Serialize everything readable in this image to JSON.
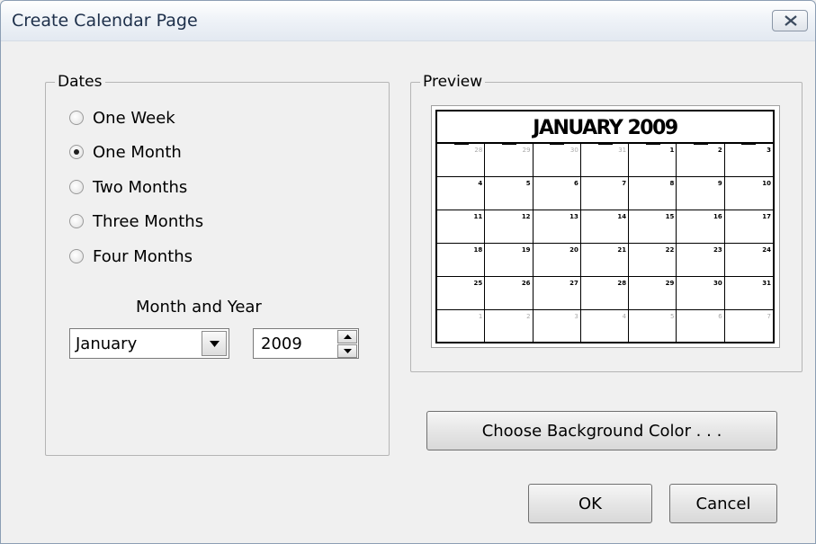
{
  "window": {
    "title": "Create Calendar Page"
  },
  "dates": {
    "legend": "Dates",
    "options": [
      {
        "label": "One Week",
        "checked": false
      },
      {
        "label": "One Month",
        "checked": true
      },
      {
        "label": "Two Months",
        "checked": false
      },
      {
        "label": "Three Months",
        "checked": false
      },
      {
        "label": "Four Months",
        "checked": false
      }
    ],
    "month_year_label": "Month and Year",
    "month_value": "January",
    "year_value": "2009"
  },
  "preview": {
    "legend": "Preview",
    "calendar_title": "JANUARY 2009",
    "weeks": [
      [
        "28",
        "29",
        "30",
        "31",
        "1",
        "2",
        "3"
      ],
      [
        "4",
        "5",
        "6",
        "7",
        "8",
        "9",
        "10"
      ],
      [
        "11",
        "12",
        "13",
        "14",
        "15",
        "16",
        "17"
      ],
      [
        "18",
        "19",
        "20",
        "21",
        "22",
        "23",
        "24"
      ],
      [
        "25",
        "26",
        "27",
        "28",
        "29",
        "30",
        "31"
      ],
      [
        "1",
        "2",
        "3",
        "4",
        "5",
        "6",
        "7"
      ]
    ]
  },
  "buttons": {
    "background_color": "Choose Background Color . . .",
    "ok": "OK",
    "cancel": "Cancel"
  }
}
